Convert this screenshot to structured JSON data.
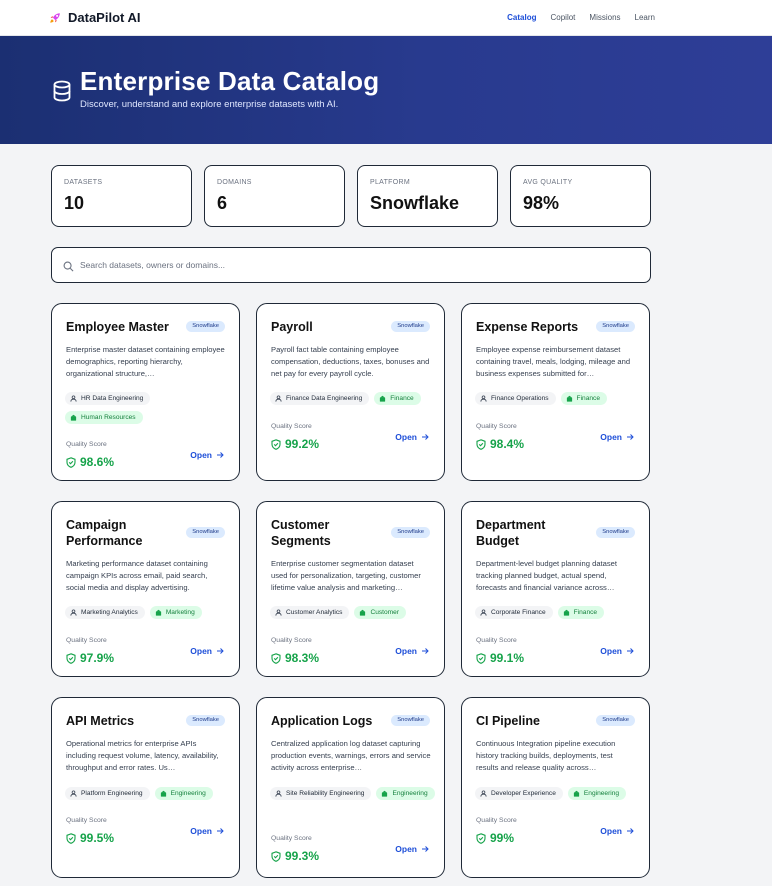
{
  "nav": {
    "brand": "DataPilot AI",
    "links": [
      "Catalog",
      "Copilot",
      "Missions",
      "Learn"
    ]
  },
  "hero": {
    "title": "Enterprise Data Catalog",
    "subtitle": "Discover, understand and explore enterprise datasets with AI."
  },
  "stats": [
    {
      "label": "DATASETS",
      "value": "10"
    },
    {
      "label": "DOMAINS",
      "value": "6"
    },
    {
      "label": "PLATFORM",
      "value": "Snowflake"
    },
    {
      "label": "AVG QUALITY",
      "value": "98%"
    }
  ],
  "search": {
    "placeholder": "Search datasets, owners or domains..."
  },
  "card_labels": {
    "quality": "Quality Score",
    "open": "Open"
  },
  "cards": [
    {
      "title": "Employee Master",
      "platform": "Snowflake",
      "description": "Enterprise master dataset containing employee demographics, reporting hierarchy, organizational structure,…",
      "owner": "HR Data Engineering",
      "domain": "Human Resources",
      "quality": "98.6%"
    },
    {
      "title": "Payroll",
      "platform": "Snowflake",
      "description": "Payroll fact table containing employee compensation, deductions, taxes, bonuses and net pay for every payroll cycle.",
      "owner": "Finance Data Engineering",
      "domain": "Finance",
      "quality": "99.2%"
    },
    {
      "title": "Expense Reports",
      "platform": "Snowflake",
      "description": "Employee expense reimbursement dataset containing travel, meals, lodging, mileage and business expenses submitted for…",
      "owner": "Finance Operations",
      "domain": "Finance",
      "quality": "98.4%"
    },
    {
      "title": "Campaign Performance",
      "platform": "Snowflake",
      "description": "Marketing performance dataset containing campaign KPIs across email, paid search, social media and display advertising.",
      "owner": "Marketing Analytics",
      "domain": "Marketing",
      "quality": "97.9%"
    },
    {
      "title": "Customer Segments",
      "platform": "Snowflake",
      "description": "Enterprise customer segmentation dataset used for personalization, targeting, customer lifetime value analysis and marketing…",
      "owner": "Customer Analytics",
      "domain": "Customer",
      "quality": "98.3%"
    },
    {
      "title": "Department Budget",
      "platform": "Snowflake",
      "description": "Department-level budget planning dataset tracking planned budget, actual spend, forecasts and financial variance across…",
      "owner": "Corporate Finance",
      "domain": "Finance",
      "quality": "99.1%"
    },
    {
      "title": "API Metrics",
      "platform": "Snowflake",
      "description": "Operational metrics for enterprise APIs including request volume, latency, availability, throughput and error rates. Us…",
      "owner": "Platform Engineering",
      "domain": "Engineering",
      "quality": "99.5%"
    },
    {
      "title": "Application Logs",
      "platform": "Snowflake",
      "description": "Centralized application log dataset capturing production events, warnings, errors and service activity across enterprise…",
      "owner": "Site Reliability Engineering",
      "domain": "Engineering",
      "quality": "99.3%"
    },
    {
      "title": "CI Pipeline",
      "platform": "Snowflake",
      "description": "Continuous Integration pipeline execution history tracking builds, deployments, test results and release quality across…",
      "owner": "Developer Experience",
      "domain": "Engineering",
      "quality": "99%"
    }
  ]
}
